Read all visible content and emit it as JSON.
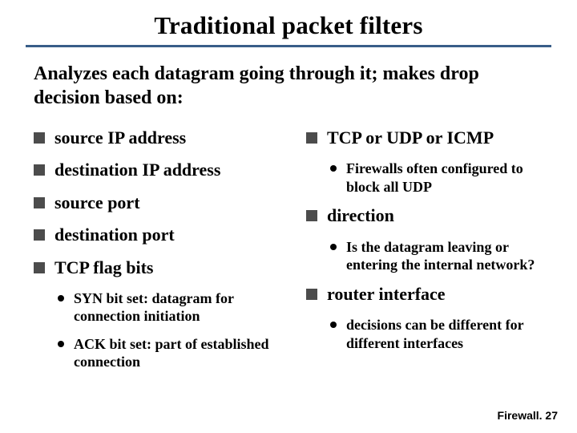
{
  "title": "Traditional packet filters",
  "intro": "Analyzes each datagram going through it; makes drop decision based on:",
  "left": {
    "items": [
      {
        "label": "source IP address"
      },
      {
        "label": "destination IP address"
      },
      {
        "label": "source port"
      },
      {
        "label": "destination port"
      },
      {
        "label": "TCP flag bits",
        "sub": [
          "SYN bit set: datagram for connection initiation",
          "ACK bit set: part of established connection"
        ]
      }
    ]
  },
  "right": {
    "items": [
      {
        "label": "TCP or UDP or ICMP",
        "sub": [
          "Firewalls often configured to block all UDP"
        ]
      },
      {
        "label": "direction",
        "sub": [
          "Is the datagram leaving or entering the internal network?"
        ]
      },
      {
        "label": "router interface",
        "sub": [
          "decisions can be different for different interfaces"
        ]
      }
    ]
  },
  "footer": "Firewall. 27"
}
